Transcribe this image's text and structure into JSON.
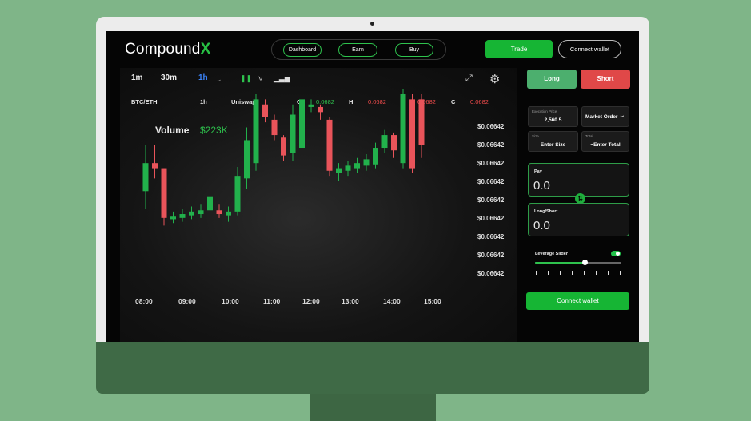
{
  "header": {
    "logo_text": "Compound",
    "logo_accent": "X",
    "nav": [
      "Dashboard",
      "Earn",
      "Buy"
    ],
    "trade_label": "Trade",
    "connect_label": "Connect wallet"
  },
  "chart": {
    "timeframes": [
      "1m",
      "30m",
      "1h"
    ],
    "active_timeframe": "1h",
    "tool_icons": [
      "candles-icon",
      "line-chart-icon",
      "bar-chart-icon"
    ],
    "info": {
      "pair": "BTC/ETH",
      "interval": "1h",
      "exchange": "Uniswap",
      "o_label": "O",
      "o_value": "0.0682",
      "h_label": "H",
      "h_value": "0.0682",
      "l_label": "L",
      "l_value": "0.0682",
      "c_label": "C",
      "c_value": "0.0682"
    },
    "volume_label": "Volume",
    "volume_value": "$223K"
  },
  "chart_data": {
    "type": "candlestick",
    "x_labels": [
      "08:00",
      "09:00",
      "10:00",
      "11:00",
      "12:00",
      "13:00",
      "14:00",
      "15:00"
    ],
    "y_labels": [
      "$0.06642",
      "$0.06642",
      "$0.06642",
      "$0.06642",
      "$0.06642",
      "$0.06642",
      "$0.06642",
      "$0.06642",
      "$0.06642"
    ],
    "candles": [
      {
        "o": 2.4,
        "c": 4.6,
        "h": 6.0,
        "l": 1.0
      },
      {
        "o": 4.6,
        "c": 4.2,
        "h": 6.0,
        "l": 3.4
      },
      {
        "o": 4.2,
        "c": 0.3,
        "h": 4.2,
        "l": -0.3
      },
      {
        "o": 0.2,
        "c": 0.4,
        "h": 0.8,
        "l": -0.1
      },
      {
        "o": 0.3,
        "c": 0.6,
        "h": 1.0,
        "l": 0.0
      },
      {
        "o": 0.5,
        "c": 0.8,
        "h": 1.2,
        "l": 0.2
      },
      {
        "o": 0.6,
        "c": 0.9,
        "h": 1.4,
        "l": 0.3
      },
      {
        "o": 0.9,
        "c": 2.0,
        "h": 2.2,
        "l": 0.8
      },
      {
        "o": 0.9,
        "c": 0.6,
        "h": 1.4,
        "l": 0.3
      },
      {
        "o": 0.5,
        "c": 0.8,
        "h": 1.2,
        "l": 0.0
      },
      {
        "o": 0.8,
        "c": 3.6,
        "h": 4.3,
        "l": 0.5
      },
      {
        "o": 3.4,
        "c": 6.4,
        "h": 7.4,
        "l": 2.6
      },
      {
        "o": 4.6,
        "c": 9.6,
        "h": 10.0,
        "l": 4.0
      },
      {
        "o": 9.2,
        "c": 8.2,
        "h": 9.6,
        "l": 7.8
      },
      {
        "o": 8.0,
        "c": 6.8,
        "h": 8.4,
        "l": 6.4
      },
      {
        "o": 6.6,
        "c": 5.2,
        "h": 6.8,
        "l": 4.8
      },
      {
        "o": 5.4,
        "c": 8.4,
        "h": 9.2,
        "l": 4.8
      },
      {
        "o": 5.8,
        "c": 9.6,
        "h": 10.0,
        "l": 5.4
      },
      {
        "o": 9.0,
        "c": 9.2,
        "h": 9.6,
        "l": 8.6
      },
      {
        "o": 9.0,
        "c": 8.6,
        "h": 9.2,
        "l": 8.0
      },
      {
        "o": 8.0,
        "c": 4.0,
        "h": 8.2,
        "l": 3.6
      },
      {
        "o": 3.8,
        "c": 4.2,
        "h": 4.6,
        "l": 3.2
      },
      {
        "o": 4.0,
        "c": 4.4,
        "h": 4.8,
        "l": 3.6
      },
      {
        "o": 4.2,
        "c": 4.6,
        "h": 5.0,
        "l": 3.8
      },
      {
        "o": 4.4,
        "c": 4.9,
        "h": 5.3,
        "l": 4.0
      },
      {
        "o": 4.5,
        "c": 5.8,
        "h": 6.2,
        "l": 4.2
      },
      {
        "o": 5.8,
        "c": 6.8,
        "h": 7.2,
        "l": 5.4
      },
      {
        "o": 6.8,
        "c": 5.6,
        "h": 7.0,
        "l": 5.0
      },
      {
        "o": 4.6,
        "c": 10.0,
        "h": 10.4,
        "l": 4.2
      },
      {
        "o": 9.6,
        "c": 4.2,
        "h": 10.0,
        "l": 3.8
      },
      {
        "o": 9.6,
        "c": 6.0,
        "h": 10.0,
        "l": 5.0
      }
    ]
  },
  "order": {
    "long_label": "Long",
    "short_label": "Short",
    "exec_price_label": "Execution Price",
    "exec_price_value": "2,560.5",
    "order_type_value": "Market Order",
    "size_label": "Size",
    "size_value": "Enter Size",
    "total_label": "Total",
    "total_value": "~Enter Total",
    "pay_label": "Pay",
    "pay_value": "0.0",
    "longshort_label": "Long/Short",
    "longshort_value": "0.0",
    "leverage_label": "Leverage Slider",
    "leverage_enabled": true,
    "leverage_fraction": 0.58,
    "connect_label": "Connect wallet"
  },
  "colors": {
    "up": "#22b14c",
    "down": "#e9545a",
    "accent": "#16b534",
    "short": "#e04848"
  }
}
